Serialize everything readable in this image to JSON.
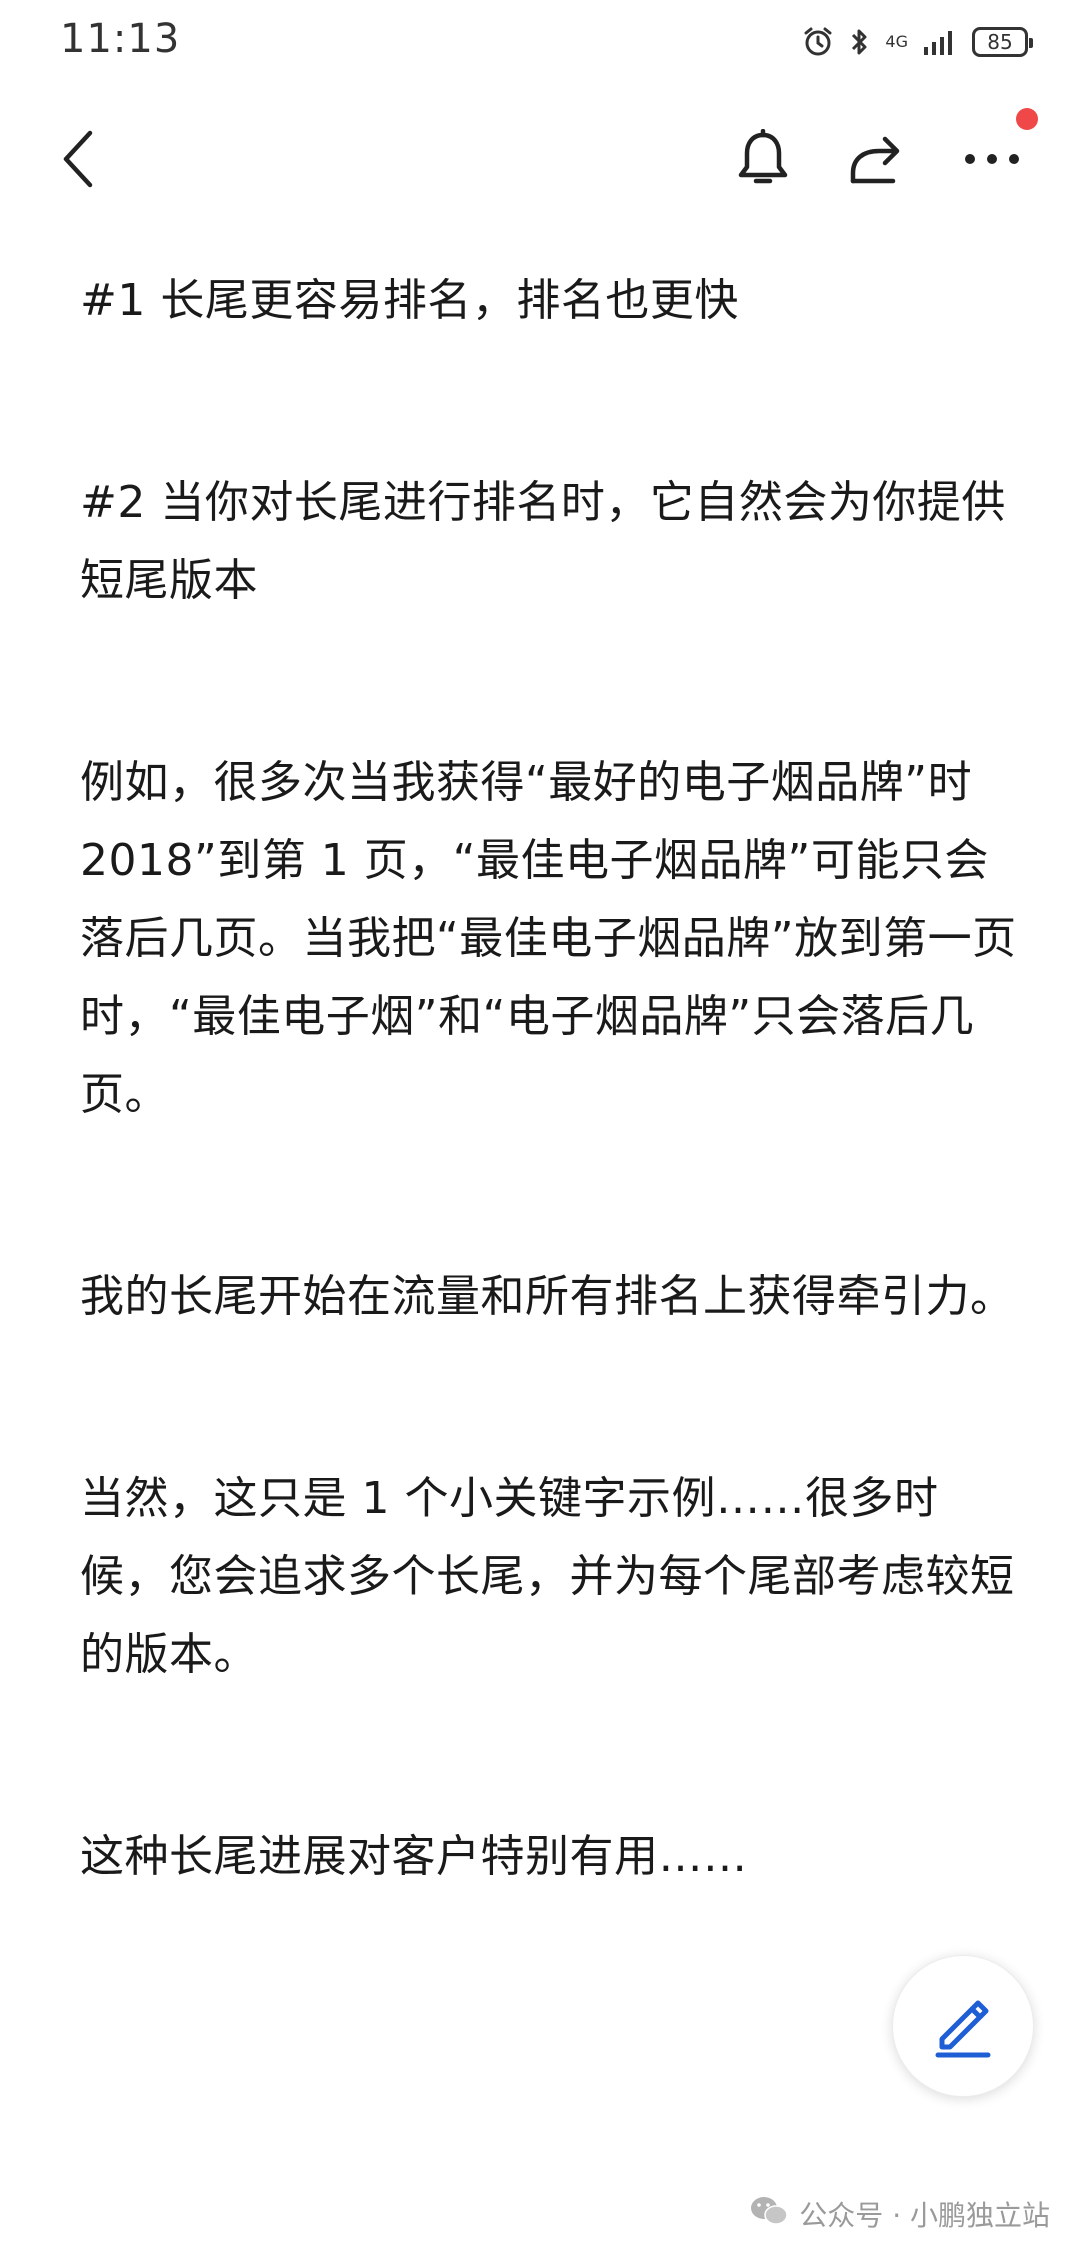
{
  "status_bar": {
    "time": "11:13",
    "network": "4G",
    "battery": "85"
  },
  "app_bar": {
    "notification_dot_color": "#f04848"
  },
  "article": {
    "paragraphs": [
      "#1 长尾更容易排名，排名也更快",
      "#2 当你对长尾进行排名时，它自然会为你提供短尾版本",
      "例如，很多次当我获得“最好的电子烟品牌”时2018”到第 1 页，“最佳电子烟品牌”可能只会落后几页。当我把“最佳电子烟品牌”放到第一页时，“最佳电子烟”和“电子烟品牌”只会落后几页。",
      "我的长尾开始在流量和所有排名上获得牵引力。",
      "当然，这只是 1 个小关键字示例……很多时候，您会追求多个长尾，并为每个尾部考虑较短的版本。",
      "这种长尾进展对客户特别有用……"
    ]
  },
  "watermark": {
    "text": "公众号 · 小鹏独立站"
  },
  "colors": {
    "accent_blue": "#1f5fd6",
    "text": "#1a1a1a"
  }
}
